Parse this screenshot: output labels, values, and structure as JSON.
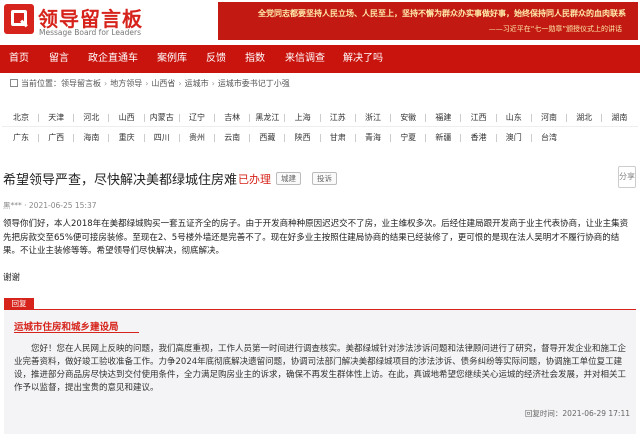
{
  "header": {
    "logo_title": "领导留言板",
    "logo_subtitle": "Message Board for Leaders",
    "banner_line1": "全党同志都要坚持人民立场、人民至上，坚持不懈为群众办实事做好事，始终保持同人民群众的血肉联系",
    "banner_line2": "——习近平在“七一勋章”颁授仪式上的讲话"
  },
  "nav": {
    "items": [
      "首页",
      "留言",
      "政企直通车",
      "案例库",
      "反馈",
      "指数",
      "来信调查",
      "解决了吗"
    ]
  },
  "breadcrumb": {
    "label": "当前位置：",
    "items": [
      "领导留言板",
      "地方领导",
      "山西省",
      "运城市",
      "运城市委书记丁小强"
    ]
  },
  "regions": {
    "row1": [
      "北京",
      "天津",
      "河北",
      "山西",
      "内蒙古",
      "辽宁",
      "吉林",
      "黑龙江",
      "上海",
      "江苏",
      "浙江",
      "安徽",
      "福建",
      "江西",
      "山东",
      "河南",
      "湖北",
      "湖南"
    ],
    "row2": [
      "广东",
      "广西",
      "海南",
      "重庆",
      "四川",
      "贵州",
      "云南",
      "西藏",
      "陕西",
      "甘肃",
      "青海",
      "宁夏",
      "新疆",
      "香港",
      "澳门",
      "台湾"
    ]
  },
  "article": {
    "title": "希望领导严查，尽快解决美都绿城住房难",
    "status": "已办理",
    "tags": [
      "城建",
      "投诉"
    ],
    "side_button": "分享",
    "meta": "黑*** · 2021-06-25 15:37",
    "body": "领导你们好，本人2018年在美都绿城购买一套五证齐全的房子。由于开发商种种原因迟迟交不了房，业主维权多次。后经住建局跟开发商于业主代表协商，让业主集资先把房款交至65%便可接房装修。至现在2、5号楼外墙还是完善不了。现在好多业主按照住建局协商的结果已经装修了，更可恨的是现在法人吴明才不履行协商的结果。不让业主装修等等。希望领导们尽快解决，彻底解决。",
    "thanks": "谢谢"
  },
  "reply": {
    "label": "回复",
    "org": "运城市住房和城乡建设局",
    "body": "您好！您在人民网上反映的问题，我们高度重视，工作人员第一时间进行调查核实。美都绿城针对涉法涉诉问题和法律顾问进行了研究，督导开发企业和施工企业完善资料，做好竣工验收准备工作。力争2024年底彻底解决遗留问题，协调司法部门解决美都绿城项目的涉法涉诉、债务纠纷等实际问题，协调施工单位复工建设，推进部分商品房尽快达到交付使用条件，全力满足购房业主的诉求，确保不再发生群体性上访。在此，真诚地希望您继续关心运城的经济社会发展，并对相关工作予以监督，提出宝贵的意见和建议。",
    "date": "回复时间：2021-06-29 17:11"
  },
  "colors": {
    "brand_red": "#d6231b",
    "nav_red": "#c9130d"
  }
}
